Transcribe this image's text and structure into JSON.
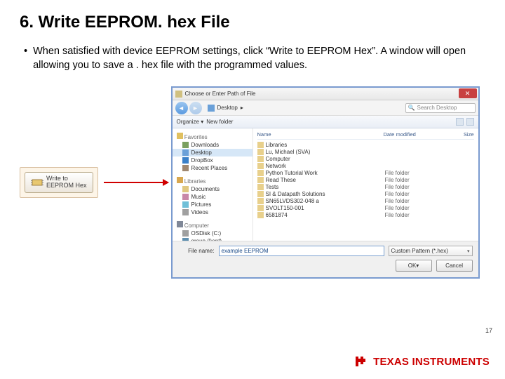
{
  "title": "6. Write EEPROM. hex File",
  "bullet": "When satisfied with device EEPROM settings, click “Write to EEPROM Hex”. A window will open allowing you to save a . hex file with the programmed values.",
  "write_button": {
    "line1": "Write to",
    "line2": "EEPROM Hex"
  },
  "dialog": {
    "title": "Choose or Enter Path of File",
    "crumb_root": "Desktop",
    "search_placeholder": "Search Desktop",
    "toolbar": {
      "organize": "Organize ▾",
      "newfolder": "New folder"
    },
    "sidebar": {
      "fav_header": "Favorites",
      "favorites": [
        "Downloads",
        "Desktop",
        "DropBox",
        "Recent Places"
      ],
      "lib_header": "Libraries",
      "libraries": [
        "Documents",
        "Music",
        "Pictures",
        "Videos"
      ],
      "comp_header": "Computer",
      "computer": [
        "OSDisk (C:)",
        "group (\\\\ent)"
      ]
    },
    "columns": {
      "name": "Name",
      "date": "Date modified",
      "size": "Size"
    },
    "rows": [
      {
        "name": "Libraries",
        "type": ""
      },
      {
        "name": "Lu, Michael (SVA)",
        "type": ""
      },
      {
        "name": "Computer",
        "type": ""
      },
      {
        "name": "Network",
        "type": ""
      },
      {
        "name": "Python Tutorial Work",
        "type": "File folder"
      },
      {
        "name": "Read These",
        "type": "File folder"
      },
      {
        "name": "Tests",
        "type": "File folder"
      },
      {
        "name": "SI & Datapath Solutions",
        "type": "File folder"
      },
      {
        "name": "SN65LVDS302-048 a",
        "type": "File folder"
      },
      {
        "name": "SVOLT150-001",
        "type": "File folder"
      },
      {
        "name": "6581874",
        "type": "File folder"
      }
    ],
    "footer": {
      "filename_label": "File name:",
      "filename_value": "example EEPROM",
      "format_value": "Custom Pattern (*.hex)",
      "ok": "OK",
      "cancel": "Cancel"
    }
  },
  "page_number": "17",
  "brand": "TEXAS INSTRUMENTS"
}
